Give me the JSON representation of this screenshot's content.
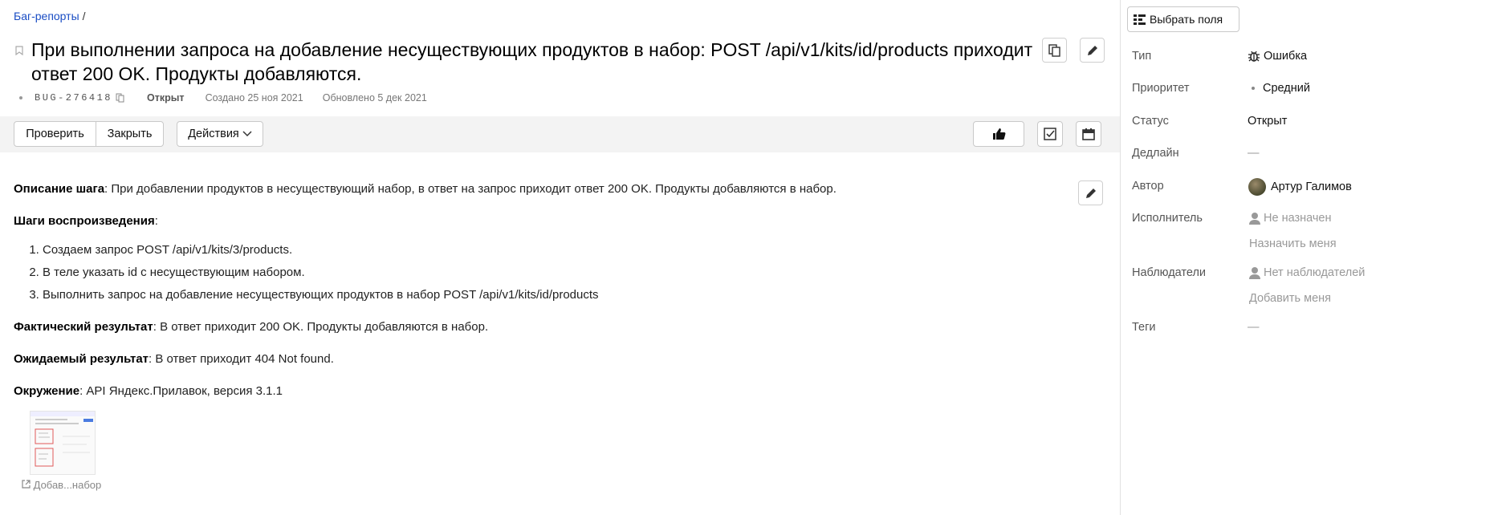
{
  "breadcrumb": {
    "root": "Баг-репорты",
    "separator": "/"
  },
  "issue": {
    "title": "При выполнении запроса на добавление несуществующих продуктов в набор: POST /api/v1/kits/id/products приходит ответ 200 OK. Продукты добавляются.",
    "key": "BUG-276418",
    "status": "Открыт",
    "created": "Создано 25 ноя 2021",
    "updated": "Обновлено 5 дек 2021"
  },
  "toolbar": {
    "check_label": "Проверить",
    "close_label": "Закрыть",
    "actions_label": "Действия"
  },
  "description": {
    "step_label": "Описание шага",
    "step_text": ": При добавлении продуктов в несуществующий набор, в ответ на запрос приходит ответ 200 OK. Продукты добавляются в набор.",
    "repro_label": "Шаги воспроизведения",
    "repro_suffix": ":",
    "steps": [
      "Создаем запрос POST /api/v1/kits/3/products.",
      "В теле указать id с несуществующим набором.",
      "Выполнить запрос на добавление несуществующих продуктов в набор POST /api/v1/kits/id/products"
    ],
    "actual_label": "Фактический результат",
    "actual_text": ": В ответ приходит 200 OK. Продукты добавляются в набор.",
    "expected_label": "Ожидаемый результат",
    "expected_text": ": В ответ приходит 404 Not found.",
    "env_label": "Окружение",
    "env_text": ": API Яндекс.Прилавок, версия 3.1.1"
  },
  "attachment": {
    "caption": "Добав...набор"
  },
  "sidebar": {
    "fields_button": "Выбрать поля",
    "type_label": "Тип",
    "type_value": "Ошибка",
    "priority_label": "Приоритет",
    "priority_value": "Средний",
    "status_label": "Статус",
    "status_value": "Открыт",
    "deadline_label": "Дедлайн",
    "deadline_value": "—",
    "author_label": "Автор",
    "author_value": "Артур Галимов",
    "assignee_label": "Исполнитель",
    "assignee_value": "Не назначен",
    "assign_me": "Назначить меня",
    "watchers_label": "Наблюдатели",
    "watchers_value": "Нет наблюдателей",
    "add_me": "Добавить меня",
    "tags_label": "Теги",
    "tags_value": "—"
  },
  "colors": {
    "link": "#1a4dc4",
    "toolbar_bg": "#f3f3f3",
    "muted": "#999999"
  }
}
